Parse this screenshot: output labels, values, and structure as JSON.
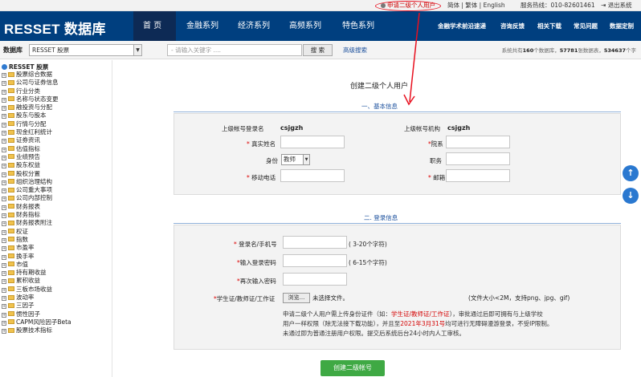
{
  "topbar": {
    "apply_link": "申请二级个人用户",
    "lang": "简体 | 繁体 | English",
    "hotline": "服务热线：010-82601461",
    "logout": "退出系统"
  },
  "nav": {
    "logo": "RESSET 数据库",
    "main": [
      "首 页",
      "金融系列",
      "经济系列",
      "高频系列",
      "特色系列"
    ],
    "sub": [
      "金融学术前沿速递",
      "咨询反馈",
      "相关下载",
      "常见问题",
      "数据定制"
    ]
  },
  "search": {
    "db_label": "数据库",
    "db_value": "RESSET 股票",
    "placeholder": "- 请输入关键字 ....",
    "button": "搜 索",
    "advanced": "高级搜索",
    "stats_prefix": "系统共有",
    "db_count": "160",
    "stats_mid1": "个数据库，",
    "table_count": "57781",
    "stats_mid2": "张数据表，",
    "field_count": "534637",
    "stats_suffix": "个字"
  },
  "sidebar": {
    "root": "RESSET 股票",
    "items": [
      "股票综合数据",
      "公司与证券信息",
      "行业分类",
      "名称与状态变更",
      "融投资与分配",
      "股东与股本",
      "行情与分配",
      "现金红利统计",
      "证券资讯",
      "估值指标",
      "业绩预告",
      "股东权益",
      "股权分置",
      "组织治理结构",
      "公司重大事项",
      "公司内部控制",
      "财务报表",
      "财务指标",
      "财务报表附注",
      "权证",
      "指数",
      "市盈率",
      "换手率",
      "市值",
      "持有期收益",
      "累积收益",
      "三板市场收益",
      "波动率",
      "三因子",
      "惯性因子",
      "CAPM风险因子Beta",
      "股票技术指标"
    ]
  },
  "form": {
    "title": "创建二级个人用户",
    "section1": "一、基本信息",
    "section2": "二. 登录信息",
    "parent_login_label": "上级帐号登录名",
    "parent_login_value": "csjgzh",
    "parent_org_label": "上级帐号机构",
    "parent_org_value": "csjgzh",
    "name_label": "真实姓名",
    "dept_label": "院系",
    "identity_label": "身份",
    "identity_value": "教师",
    "position_label": "职务",
    "phone_label": "移动电话",
    "email_label": "邮箱",
    "login_label": "登录名/手机号",
    "login_hint": "( 3-20个字符)",
    "pwd_label": "输入登录密码",
    "pwd_hint": "( 6-15个字符)",
    "pwd2_label": "再次输入密码",
    "cert_label": "学生证/教师证/工作证",
    "browse": "浏览...",
    "no_file": "未选择文件。",
    "file_hint": "(文件大小<2M，支持png、jpg、gif)",
    "note1_a": "申请二级个人用户需上传身份证件（如：",
    "note1_red": "学生证/教师证/工作证",
    "note1_b": "），审批通过后即可拥有与上级学校",
    "note2_a": "用户一样权限（除无法接下载功能），并且至",
    "note2_red": "2021年3月31号",
    "note2_b": "均可进行无障碍漫游登录，不受IP限制。",
    "note3": "未通过即为普通注册用户权限。提交后系统后台24小时内人工审核。",
    "submit": "创建二级帐号"
  },
  "colors": {
    "nav_bg": "#003f7f",
    "accent": "#1a4f9c",
    "submit": "#3fa944",
    "highlight": "#e8101f"
  }
}
